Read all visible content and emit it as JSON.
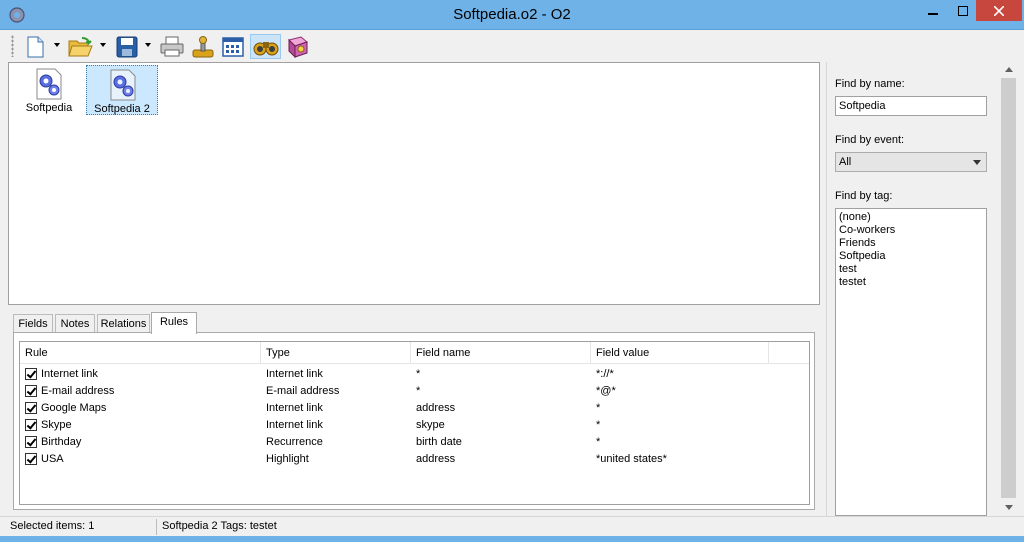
{
  "window": {
    "title": "Softpedia.o2 - O2"
  },
  "toolbar": {
    "buttons": [
      {
        "name": "new-document",
        "icon": "new-document-icon"
      },
      {
        "name": "open-folder",
        "icon": "open-folder-icon"
      },
      {
        "name": "save",
        "icon": "floppy-disk-icon"
      },
      {
        "name": "print",
        "icon": "printer-icon"
      },
      {
        "name": "joystick",
        "icon": "joystick-icon"
      },
      {
        "name": "calendar",
        "icon": "calendar-grid-icon"
      },
      {
        "name": "find",
        "icon": "binoculars-icon",
        "active": true
      },
      {
        "name": "help",
        "icon": "help-book-icon"
      }
    ]
  },
  "icon_view": {
    "items": [
      {
        "label": "Softpedia",
        "selected": false
      },
      {
        "label": "Softpedia 2",
        "selected": true
      }
    ]
  },
  "tabs": [
    {
      "label": "Fields",
      "active": false
    },
    {
      "label": "Notes",
      "active": false
    },
    {
      "label": "Relations",
      "active": false
    },
    {
      "label": "Rules",
      "active": true
    }
  ],
  "rules_table": {
    "columns": [
      "Rule",
      "Type",
      "Field name",
      "Field value"
    ],
    "rows": [
      {
        "checked": true,
        "rule": "Internet link",
        "type": "Internet link",
        "field_name": "*",
        "field_value": "*://*"
      },
      {
        "checked": true,
        "rule": "E-mail address",
        "type": "E-mail address",
        "field_name": "*",
        "field_value": "*@*"
      },
      {
        "checked": true,
        "rule": "Google Maps",
        "type": "Internet link",
        "field_name": "address",
        "field_value": "*"
      },
      {
        "checked": true,
        "rule": "Skype",
        "type": "Internet link",
        "field_name": "skype",
        "field_value": "*"
      },
      {
        "checked": true,
        "rule": "Birthday",
        "type": "Recurrence",
        "field_name": "birth date",
        "field_value": "*"
      },
      {
        "checked": true,
        "rule": "USA",
        "type": "Highlight",
        "field_name": "address",
        "field_value": "*united states*"
      }
    ]
  },
  "find_panel": {
    "by_name_label": "Find by name:",
    "by_name_value": "Softpedia",
    "by_event_label": "Find by event:",
    "by_event_value": "All",
    "by_tag_label": "Find by tag:",
    "tags": [
      "(none)",
      "Co-workers",
      "Friends",
      "Softpedia",
      "test",
      "testet"
    ]
  },
  "status_bar": {
    "selected": "Selected items: 1",
    "info": "Softpedia 2 Tags: testet"
  },
  "colors": {
    "titlebar": "#6fb2e7",
    "close": "#c7463e",
    "selection": "#cce8ff"
  }
}
